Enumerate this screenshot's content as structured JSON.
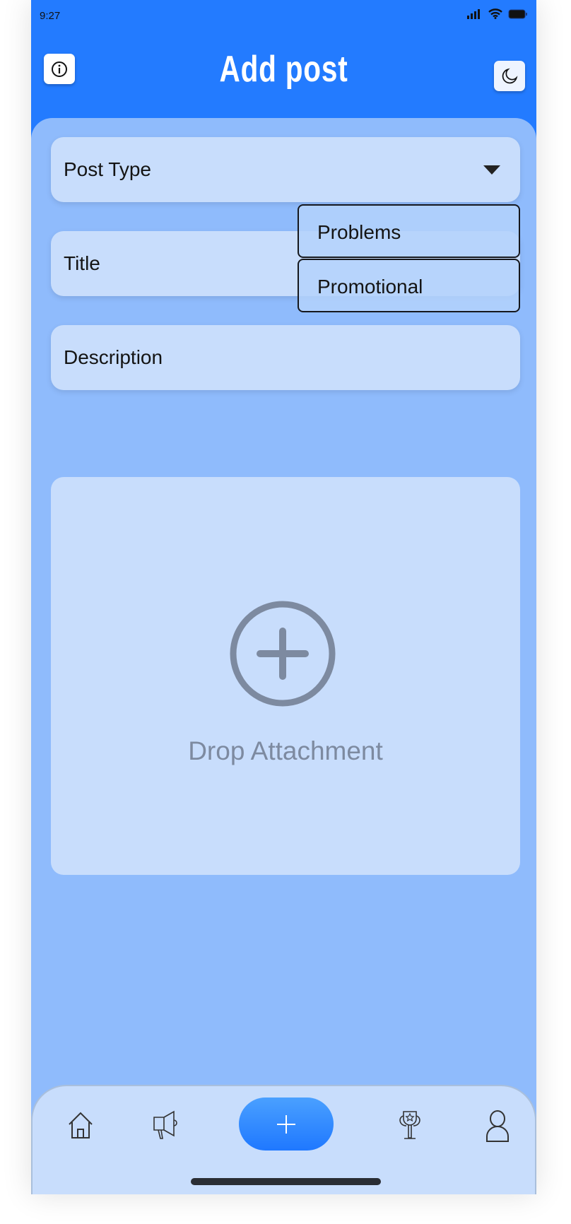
{
  "status_bar": {
    "time": "9:27"
  },
  "header": {
    "title": "Add post",
    "info_icon": "info-icon",
    "theme_icon": "moon-icon"
  },
  "form": {
    "post_type": {
      "placeholder": "Post Type",
      "options": [
        "Problems",
        "Promotional"
      ]
    },
    "title": {
      "placeholder": "Title"
    },
    "description": {
      "placeholder": "Description"
    },
    "attachment": {
      "label": "Drop Attachment",
      "icon": "plus-circle-icon"
    }
  },
  "bottom_nav": {
    "items": [
      "home-icon",
      "megaphone-icon",
      "plus-icon",
      "trophy-icon",
      "person-icon"
    ]
  },
  "colors": {
    "header": "#237bff",
    "panel": "#8fbbfc",
    "field": "#c8ddfc",
    "accent": "#1f78ff"
  }
}
